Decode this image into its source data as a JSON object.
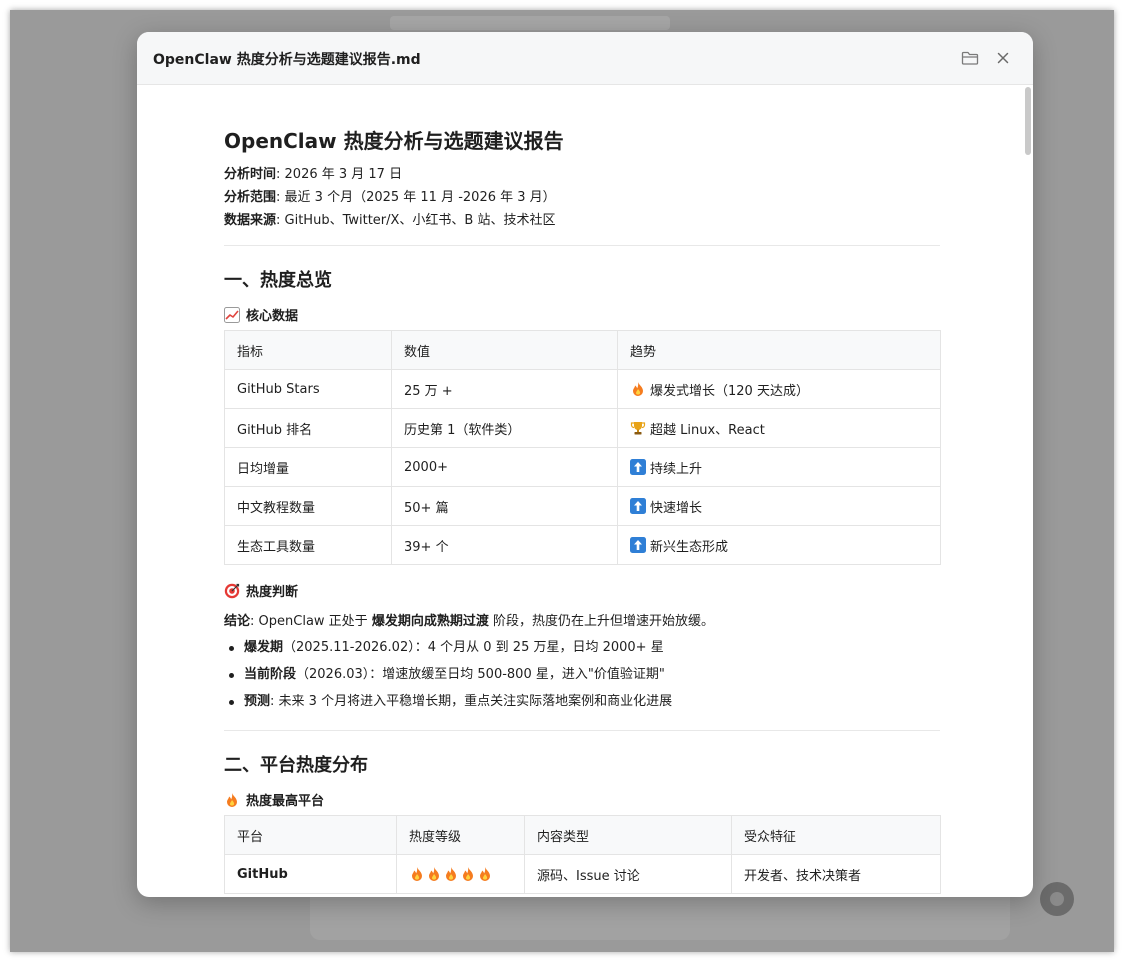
{
  "window": {
    "title": "OpenClaw 热度分析与选题建议报告.md"
  },
  "doc": {
    "title": "OpenClaw 热度分析与选题建议报告",
    "meta": [
      {
        "label": "分析时间",
        "value": ": 2026 年 3 月 17 日"
      },
      {
        "label": "分析范围",
        "value": ": 最近 3 个月（2025 年 11 月 -2026 年 3 月）"
      },
      {
        "label": "数据来源",
        "value": ": GitHub、Twitter/X、小红书、B 站、技术社区"
      }
    ],
    "section1": {
      "title": "一、热度总览",
      "core_title": "核心数据",
      "table": {
        "headers": [
          "指标",
          "数值",
          "趋势"
        ],
        "rows": [
          {
            "metric": "GitHub Stars",
            "value": "25 万 +",
            "icon": "fire-icon",
            "trend": "爆发式增长（120 天达成）"
          },
          {
            "metric": "GitHub 排名",
            "value": "历史第 1（软件类）",
            "icon": "trophy-icon",
            "trend": "超越 Linux、React"
          },
          {
            "metric": "日均增量",
            "value": "2000+",
            "icon": "up-arrow-icon",
            "trend": "持续上升"
          },
          {
            "metric": "中文教程数量",
            "value": "50+ 篇",
            "icon": "up-arrow-icon",
            "trend": "快速增长"
          },
          {
            "metric": "生态工具数量",
            "value": "39+ 个",
            "icon": "up-arrow-icon",
            "trend": "新兴生态形成"
          }
        ]
      },
      "judge_title": "热度判断",
      "conclusion": {
        "label": "结论",
        "pre": ": OpenClaw 正处于 ",
        "strong": "爆发期向成熟期过渡",
        "post": " 阶段，热度仍在上升但增速开始放缓。"
      },
      "bullets": [
        {
          "strong": "爆发期",
          "text": "（2025.11-2026.02）：4 个月从 0 到 25 万星，日均 2000+ 星"
        },
        {
          "strong": "当前阶段",
          "text": "（2026.03）：增速放缓至日均 500-800 星，进入\"价值验证期\""
        },
        {
          "strong": "预测",
          "text": ": 未来 3 个月将进入平稳增长期，重点关注实际落地案例和商业化进展"
        }
      ]
    },
    "section2": {
      "title": "二、平台热度分布",
      "top_title": "热度最高平台",
      "table": {
        "headers": [
          "平台",
          "热度等级",
          "内容类型",
          "受众特征"
        ],
        "rows": [
          {
            "platform": "GitHub",
            "fire_level": 5,
            "content": "源码、Issue 讨论",
            "audience": "开发者、技术决策者"
          }
        ]
      }
    }
  },
  "colors": {
    "backdrop": "#9a9a9a",
    "header_bg": "#f6f7f8",
    "table_header_bg": "#f8f9fa",
    "border": "#e4e4e4",
    "text": "#1f1f1f"
  }
}
